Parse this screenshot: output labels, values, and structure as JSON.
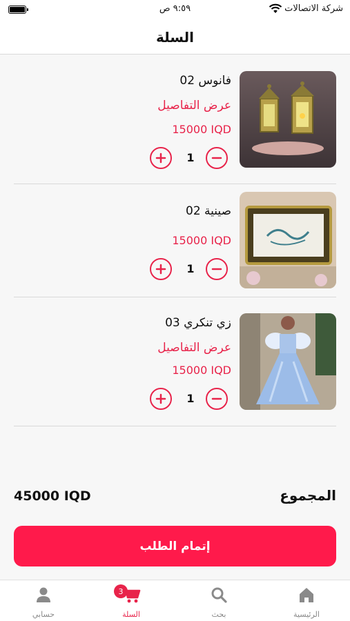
{
  "status_bar": {
    "carrier": "شركة الاتصالات",
    "time": "٩:٥٩ ص"
  },
  "header": {
    "title": "السلة"
  },
  "cart": {
    "items": [
      {
        "name": "فانوس 02",
        "details_link": "عرض التفاصيل",
        "price": "15000 IQD",
        "quantity": "1",
        "image_icon": "lantern-photo"
      },
      {
        "name": "صينية 02",
        "details_link": "",
        "price": "15000 IQD",
        "quantity": "1",
        "image_icon": "tray-photo"
      },
      {
        "name": "زي تنكري 03",
        "details_link": "عرض التفاصيل",
        "price": "15000 IQD",
        "quantity": "1",
        "image_icon": "costume-photo"
      }
    ]
  },
  "summary": {
    "total_label": "المجموع",
    "total_value": "45000 IQD"
  },
  "checkout": {
    "label": "إتمام الطلب"
  },
  "tab_bar": {
    "tabs": [
      {
        "label": "الرئيسية",
        "icon": "home-icon",
        "active": false
      },
      {
        "label": "بحث",
        "icon": "search-icon",
        "active": false
      },
      {
        "label": "السلة",
        "icon": "cart-icon",
        "active": true,
        "badge": "3"
      },
      {
        "label": "حسابي",
        "icon": "person-icon",
        "active": false
      }
    ]
  },
  "colors": {
    "accent": "#e8234a",
    "button": "#ff1a4b",
    "tab_inactive": "#888888"
  }
}
